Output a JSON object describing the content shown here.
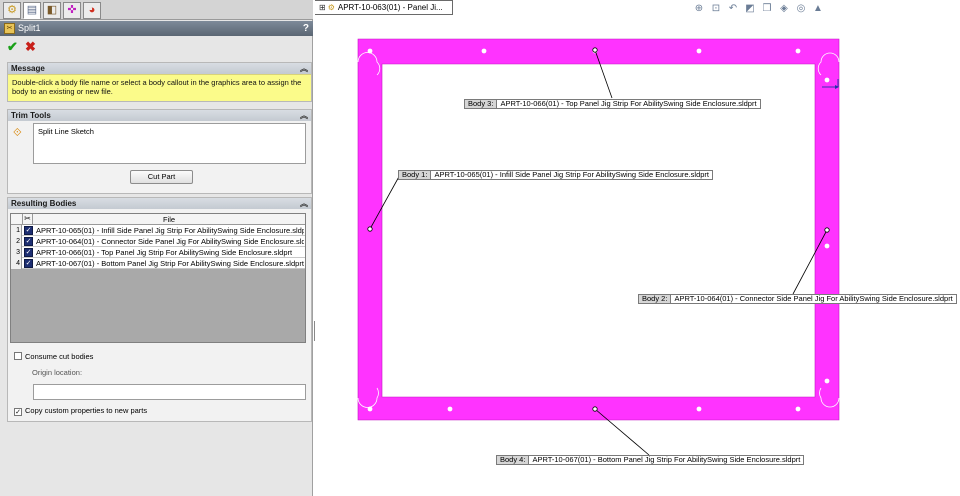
{
  "panel": {
    "tab_icons": [
      "feature-manager-icon",
      "property-manager-icon",
      "configuration-manager-icon",
      "dimxpert-icon",
      "display-manager-icon"
    ],
    "title": "Split1",
    "help": "?",
    "ok_symbol": "✔",
    "cancel_symbol": "✖"
  },
  "message": {
    "header": "Message",
    "text": "Double-click a body file name or select a body callout in the graphics area to assign the body to an existing or new file."
  },
  "trim_tools": {
    "header": "Trim Tools",
    "items": [
      "Split Line Sketch"
    ],
    "cut_part_button": "Cut Part"
  },
  "resulting_bodies": {
    "header": "Resulting Bodies",
    "column_file": "File",
    "rows": [
      {
        "num": "1",
        "checked": true,
        "file": "APRT-10-065(01) - Infill Side Panel Jig Strip For AbilitySwing Side Enclosure.sldp"
      },
      {
        "num": "2",
        "checked": true,
        "file": "APRT-10-064(01) - Connector Side Panel Jig For AbilitySwing Side Enclosure.sld"
      },
      {
        "num": "3",
        "checked": true,
        "file": "APRT-10-066(01) - Top Panel Jig Strip For AbilitySwing Side Enclosure.sldprt"
      },
      {
        "num": "4",
        "checked": true,
        "file": "APRT-10-067(01) - Bottom Panel Jig Strip For AbilitySwing Side Enclosure.sldprt"
      }
    ],
    "consume_cut_bodies": {
      "label": "Consume cut bodies",
      "checked": false
    },
    "origin_location_label": "Origin location:",
    "origin_location_value": "",
    "copy_custom_properties": {
      "label": "Copy custom properties to new parts",
      "checked": true
    }
  },
  "graphics": {
    "document_tab": "APRT-10-063(01) - Panel Ji...",
    "view_toolbar_icons": [
      "zoom-to-fit-icon",
      "zoom-to-area-icon",
      "previous-view-icon",
      "section-view-icon",
      "view-orientation-icon",
      "display-style-icon",
      "hide-show-items-icon",
      "appearance-icon"
    ],
    "frame_color": "#ff33ff",
    "callouts": [
      {
        "tag": "Body  3:",
        "name": "APRT-10-066(01) - Top Panel Jig Strip For AbilitySwing Side Enclosure.sldprt"
      },
      {
        "tag": "Body  1:",
        "name": "APRT-10-065(01) - Infill Side Panel Jig Strip For AbilitySwing Side Enclosure.sldprt"
      },
      {
        "tag": "Body  2:",
        "name": "APRT-10-064(01) - Connector Side Panel Jig For AbilitySwing Side Enclosure.sldprt"
      },
      {
        "tag": "Body  4:",
        "name": "APRT-10-067(01) - Bottom Panel Jig Strip For AbilitySwing Side Enclosure.sldprt"
      }
    ]
  }
}
